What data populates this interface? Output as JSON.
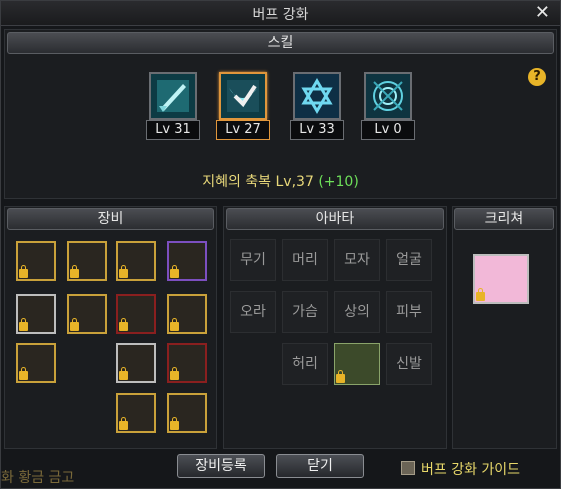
{
  "window": {
    "title": "버프 강화",
    "close_label": "✕"
  },
  "skill_section": {
    "title": "스킬"
  },
  "skills": [
    {
      "icon": "sword-icon",
      "level": "Lv 31",
      "selected": false
    },
    {
      "icon": "wings-icon",
      "level": "Lv 27",
      "selected": true
    },
    {
      "icon": "hexagram-icon",
      "level": "Lv 33",
      "selected": false
    },
    {
      "icon": "magic-circle-icon",
      "level": "Lv 0",
      "selected": false
    }
  ],
  "help_label": "?",
  "buff": {
    "text": "지혜의 축복 Lv,37",
    "bonus": "(+10)"
  },
  "equipment": {
    "title": "장비"
  },
  "avatar": {
    "title": "아바타",
    "slots": [
      "무기",
      "머리",
      "모자",
      "얼굴",
      "오라",
      "가슴",
      "상의",
      "피부",
      "허리",
      "신발"
    ]
  },
  "creature": {
    "title": "크리쳐"
  },
  "buttons": {
    "register": "장비등록",
    "close": "닫기"
  },
  "guide": {
    "label": "버프 강화 가이드"
  },
  "background_text": "화 황금 금고",
  "colors": {
    "accent": "#e0963c",
    "buff_text": "#e8d87a",
    "bonus": "#6ee05a"
  }
}
